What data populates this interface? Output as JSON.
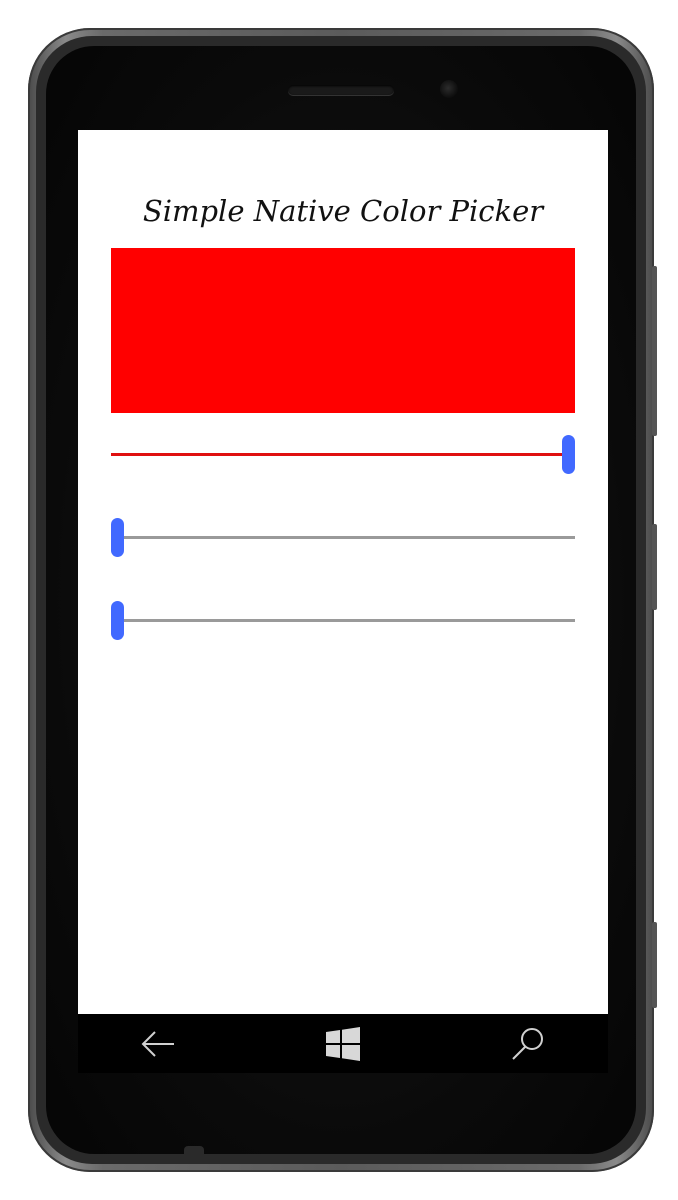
{
  "app": {
    "title": "Simple Native Color Picker"
  },
  "preview": {
    "color": "#ff0000"
  },
  "sliders": [
    {
      "channel": "red",
      "value": 1.0,
      "fill_color": "#e01010"
    },
    {
      "channel": "green",
      "value": 0.0,
      "fill_color": "#9a9a9a"
    },
    {
      "channel": "blue",
      "value": 0.0,
      "fill_color": "#9a9a9a"
    }
  ],
  "theme": {
    "thumb_color": "#4169ff",
    "track_color": "#9a9a9a",
    "navbar_bg": "#000000",
    "screen_bg": "#ffffff"
  },
  "navbar": {
    "buttons": [
      {
        "name": "back",
        "icon": "back-arrow-icon"
      },
      {
        "name": "start",
        "icon": "windows-logo-icon"
      },
      {
        "name": "search",
        "icon": "search-icon"
      }
    ]
  }
}
